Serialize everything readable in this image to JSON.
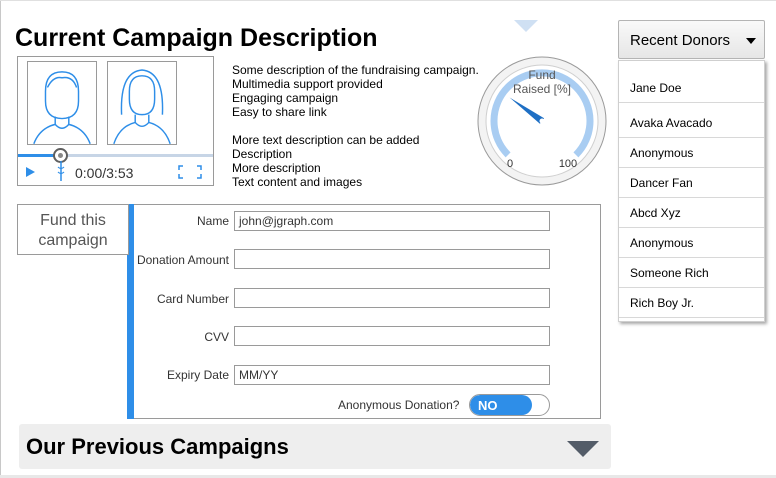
{
  "page": {
    "title": "Current Campaign Description"
  },
  "video": {
    "time": "0:00/3:53",
    "progress_fraction": 0.22,
    "icons": [
      "person-icon",
      "play-icon",
      "volume-icon",
      "fullscreen-icon"
    ]
  },
  "description": {
    "lines_1": [
      "Some description of the fundraising campaign.",
      "Multimedia support provided",
      "Engaging campaign",
      "Easy to share link"
    ],
    "lines_2": [
      "More text description can be added",
      "Description",
      "More description",
      "Text content and images"
    ]
  },
  "gauge": {
    "label_line1": "Fund",
    "label_line2": "Raised [%]",
    "min": "0",
    "max": "100",
    "value": 30
  },
  "donors": {
    "button_label": "Recent Donors",
    "items": [
      "Jane Doe",
      "Avaka Avacado",
      "Anonymous",
      "Dancer Fan",
      "Abcd Xyz",
      "Anonymous",
      "Someone Rich",
      "Rich Boy Jr."
    ]
  },
  "fund": {
    "tab_line1": "Fund this",
    "tab_line2": "campaign",
    "fields": {
      "name": {
        "label": "Name",
        "value": "john@jgraph.com"
      },
      "amount": {
        "label": "Donation Amount",
        "value": ""
      },
      "card": {
        "label": "Card Number",
        "value": ""
      },
      "cvv": {
        "label": "CVV",
        "value": ""
      },
      "expiry": {
        "label": "Expiry Date",
        "placeholder": "MM/YY"
      }
    },
    "anonymous_label": "Anonymous Donation?",
    "toggle_text": "NO"
  },
  "previous": {
    "title": "Our Previous Campaigns"
  },
  "colors": {
    "accent": "#2e8ee8",
    "gauge_arc": "#a9cdf2",
    "caret": "#535c68"
  }
}
